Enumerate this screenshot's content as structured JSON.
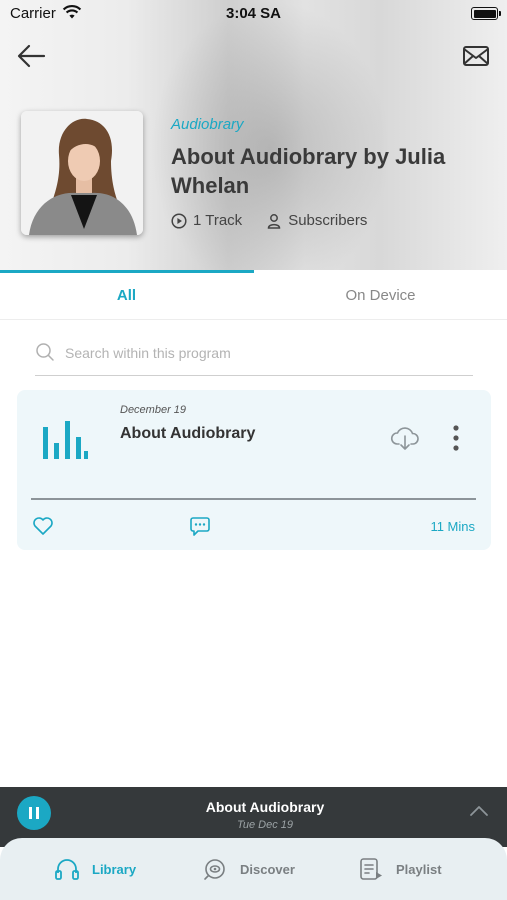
{
  "status_bar": {
    "carrier": "Carrier",
    "time": "3:04 SA"
  },
  "program": {
    "publisher": "Audiobrary",
    "title": "About Audiobrary by Julia Whelan",
    "track_count": "1 Track",
    "subscribers_label": "Subscribers"
  },
  "tabs": [
    {
      "label": "All",
      "active": true
    },
    {
      "label": "On Device",
      "active": false
    }
  ],
  "search": {
    "placeholder": "Search within this program",
    "value": ""
  },
  "tracks": [
    {
      "date": "December 19",
      "title": "About Audiobrary",
      "duration": "11 Mins",
      "progress": 0
    }
  ],
  "player": {
    "title": "About Audiobrary",
    "date": "Tue Dec 19",
    "state": "playing"
  },
  "bottom_nav": [
    {
      "label": "Library",
      "icon": "headphones-icon",
      "active": true
    },
    {
      "label": "Discover",
      "icon": "discover-icon",
      "active": false
    },
    {
      "label": "Playlist",
      "icon": "playlist-icon",
      "active": false
    }
  ],
  "colors": {
    "accent": "#1ba8c4",
    "player_bg": "#35393b",
    "card_bg": "#eef7fa",
    "nav_bg": "#e8eff2"
  }
}
